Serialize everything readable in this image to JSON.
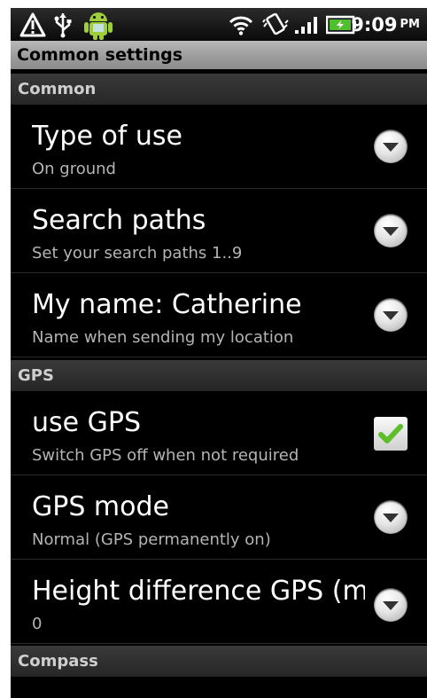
{
  "status_bar": {
    "time": "9:09",
    "ampm": "PM",
    "icons": [
      "warning-icon",
      "usb-icon",
      "android-icon",
      "wifi-icon",
      "vibrate-icon",
      "signal-icon",
      "battery-icon"
    ]
  },
  "title": "Common settings",
  "sections": [
    {
      "header": "Common",
      "items": [
        {
          "title": "Type of use",
          "summary": "On ground",
          "widget": "dropdown"
        },
        {
          "title": "Search paths",
          "summary": "Set your search paths 1..9",
          "widget": "dropdown"
        },
        {
          "title": "My name: Catherine",
          "summary": "Name when sending my location",
          "widget": "dropdown"
        }
      ]
    },
    {
      "header": "GPS",
      "items": [
        {
          "title": "use GPS",
          "summary": "Switch GPS off when not required",
          "widget": "checkbox",
          "checked": true
        },
        {
          "title": "GPS mode",
          "summary": "Normal (GPS permanently on)",
          "widget": "dropdown"
        },
        {
          "title": "Height difference GPS (m",
          "summary": "0",
          "widget": "dropdown"
        }
      ]
    },
    {
      "header": "Compass",
      "items": []
    }
  ],
  "colors": {
    "background": "#000000",
    "title_bar": "#a8a8a8",
    "checkmark": "#5cbf2a"
  }
}
